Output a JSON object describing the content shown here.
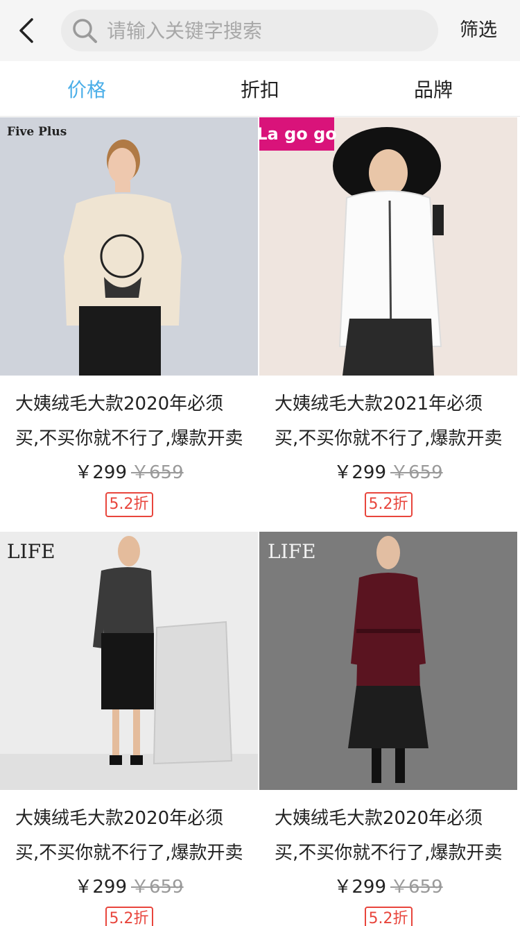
{
  "header": {
    "search": {
      "placeholder": "请输入关键字搜索",
      "value": ""
    },
    "filter_label": "筛选"
  },
  "tabs": [
    {
      "label": "价格",
      "active": true
    },
    {
      "label": "折扣",
      "active": false
    },
    {
      "label": "品牌",
      "active": false
    }
  ],
  "colors": {
    "accent": "#4aaee8",
    "discount": "#e8453c",
    "old_price": "#9a9a9a",
    "topbar_bg": "#f5f5f5"
  },
  "products": [
    {
      "brand_logo": "Five Plus",
      "name": "大姨绒毛大款2020年必须买,不买你就不行了,爆款开卖",
      "price": "￥299",
      "original_price": "￥659",
      "discount": "5.2折"
    },
    {
      "brand_logo": "La go go",
      "name": "大姨绒毛大款2021年必须买,不买你就不行了,爆款开卖",
      "price": "￥299",
      "original_price": "￥659",
      "discount": "5.2折"
    },
    {
      "brand_logo": "LIFE",
      "name": "大姨绒毛大款2020年必须买,不买你就不行了,爆款开卖",
      "price": "￥299",
      "original_price": "￥659",
      "discount": "5.2折"
    },
    {
      "brand_logo": "LIFE",
      "name": "大姨绒毛大款2020年必须买,不买你就不行了,爆款开卖",
      "price": "￥299",
      "original_price": "￥659",
      "discount": "5.2折"
    }
  ]
}
